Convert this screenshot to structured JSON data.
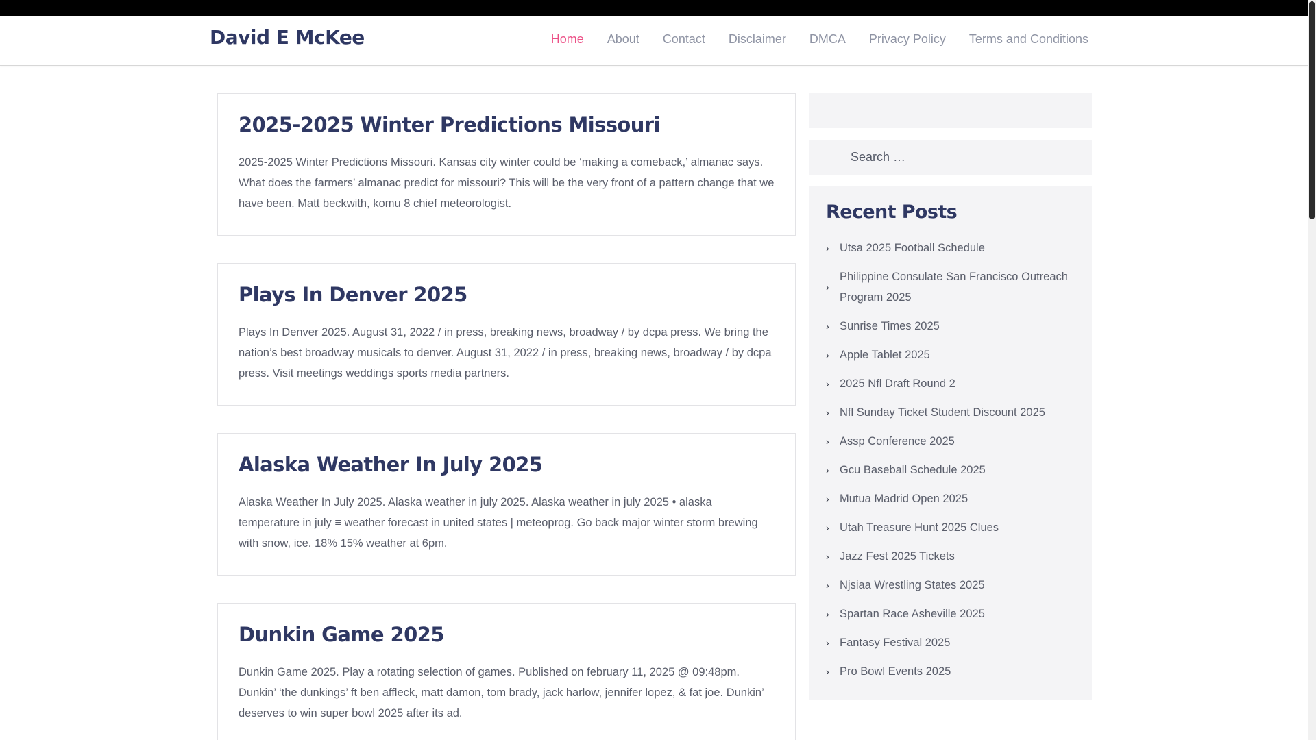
{
  "site": {
    "title": "David E McKee"
  },
  "nav": [
    {
      "label": "Home",
      "active": true
    },
    {
      "label": "About"
    },
    {
      "label": "Contact"
    },
    {
      "label": "Disclaimer"
    },
    {
      "label": "DMCA"
    },
    {
      "label": "Privacy Policy"
    },
    {
      "label": "Terms and Conditions"
    }
  ],
  "posts": [
    {
      "title": "2025-2025 Winter Predictions Missouri",
      "excerpt": "2025-2025 Winter Predictions Missouri. Kansas city winter could be ‘making a comeback,’ almanac says. What does the farmers’ almanac predict for missouri? This will be the very front of a pattern change that we have been. Matt beckwith, komu 8 chief meteorologist."
    },
    {
      "title": "Plays In Denver 2025",
      "excerpt": "Plays In Denver 2025. August 31, 2022 / in press, breaking news, broadway / by dcpa press. We bring the nation’s best broadway musicals to denver. August 31, 2022 / in press, breaking news, broadway / by dcpa press. Visit meetings weddings sports media partners."
    },
    {
      "title": "Alaska Weather In July 2025",
      "excerpt": "Alaska Weather In July 2025. Alaska weather in july 2025. Alaska weather in july 2025 • alaska temperature in july ≡ weather forecast in united states | meteoprog. Go back major winter storm brewing with snow, ice. 18% 15% weather at 6pm."
    },
    {
      "title": "Dunkin Game 2025",
      "excerpt": "Dunkin Game 2025. Play a rotating selection of games. Published on february 11, 2025 @ 09:48pm. Dunkin’ ‘the dunkings’ ft ben affleck, matt damon, tom brady, jack harlow, jennifer lopez, & fat joe. Dunkin’ deserves to win super bowl 2025 after its ad."
    }
  ],
  "sidebar": {
    "search_placeholder": "Search …",
    "recent_title": "Recent Posts",
    "recent_posts": [
      "Utsa 2025 Football Schedule",
      "Philippine Consulate San Francisco Outreach Program 2025",
      "Sunrise Times 2025",
      "Apple Tablet 2025",
      "2025 Nfl Draft Round 2",
      "Nfl Sunday Ticket Student Discount 2025",
      "Assp Conference 2025",
      "Gcu Baseball Schedule 2025",
      "Mutua Madrid Open 2025",
      "Utah Treasure Hunt 2025 Clues",
      "Jazz Fest 2025 Tickets",
      "Njsiaa Wrestling States 2025",
      "Spartan Race Asheville 2025",
      "Fantasy Festival 2025",
      "Pro Bowl Events 2025"
    ]
  },
  "colors": {
    "accent": "#ec4f86",
    "heading": "#2f3863",
    "nav_text": "#8f94a4",
    "widget_bg": "#f4f4f6"
  },
  "icons": {
    "recent_bullet": "chevron-right-icon"
  }
}
